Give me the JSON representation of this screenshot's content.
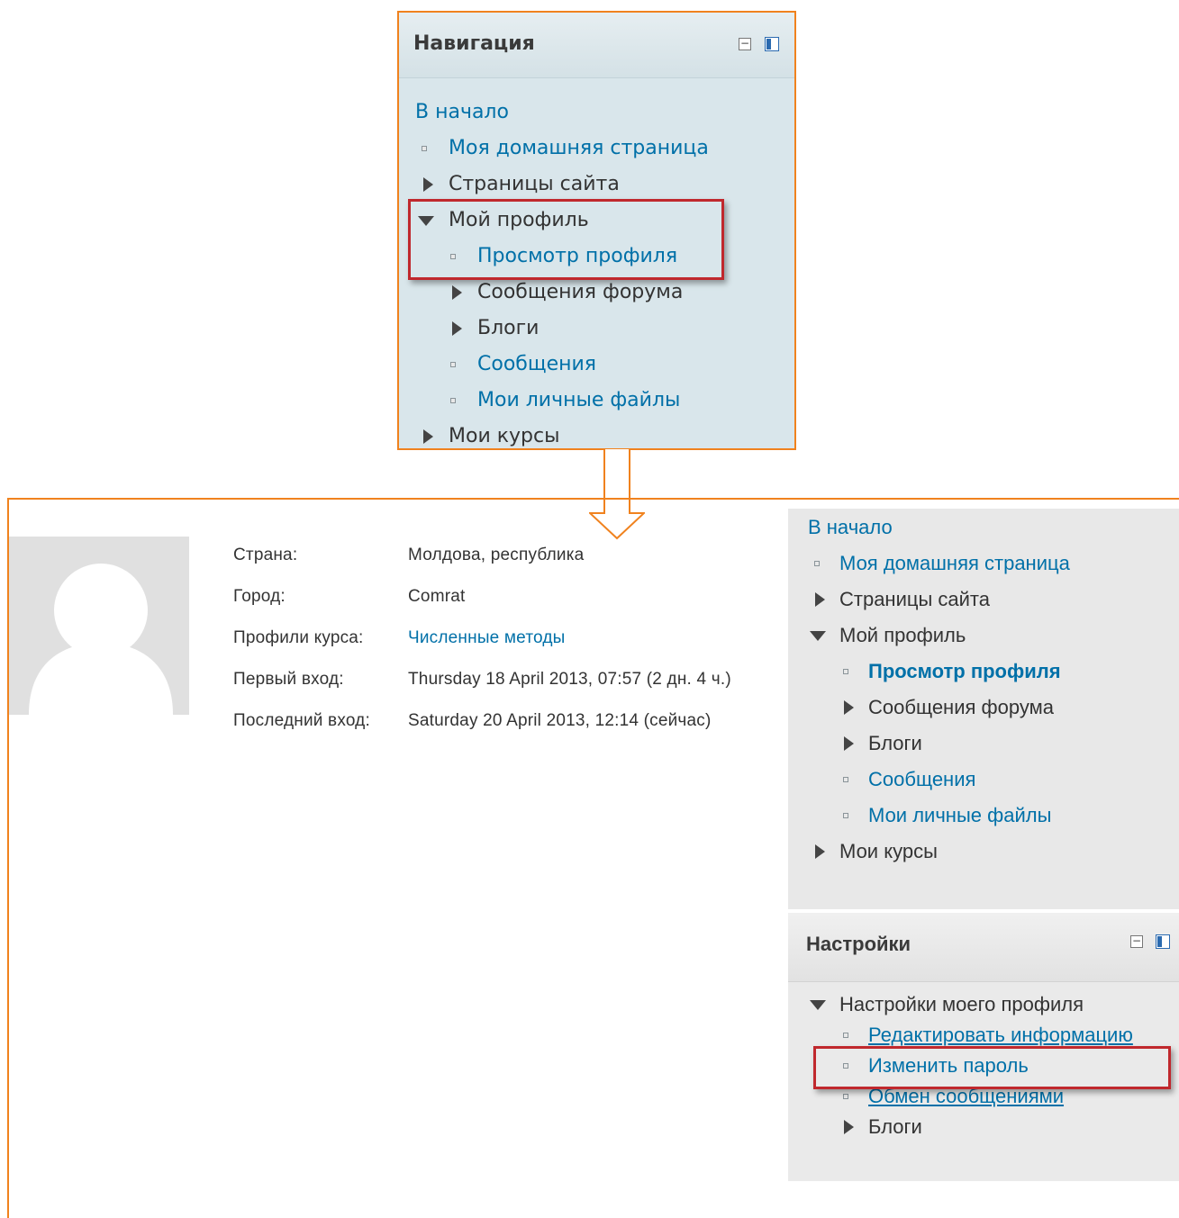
{
  "navigation_block": {
    "title": "Навигация",
    "items": [
      {
        "label": "В начало",
        "type": "link",
        "icon": "none"
      },
      {
        "label": "Моя домашняя страница",
        "type": "link",
        "icon": "bullet"
      },
      {
        "label": "Страницы сайта",
        "type": "branch",
        "icon": "triangle-right"
      },
      {
        "label": "Мой профиль",
        "type": "branch",
        "icon": "triangle-down"
      },
      {
        "label": "Просмотр профиля",
        "type": "link",
        "icon": "bullet"
      },
      {
        "label": "Сообщения форума",
        "type": "branch",
        "icon": "triangle-right"
      },
      {
        "label": "Блоги",
        "type": "branch",
        "icon": "triangle-right"
      },
      {
        "label": "Сообщения",
        "type": "link",
        "icon": "bullet"
      },
      {
        "label": "Мои личные файлы",
        "type": "link",
        "icon": "bullet"
      },
      {
        "label": "Мои курсы",
        "type": "branch",
        "icon": "triangle-right"
      }
    ]
  },
  "profile": {
    "fields": [
      {
        "label": "Страна:",
        "value": "Молдова, республика"
      },
      {
        "label": "Город:",
        "value": "Comrat"
      },
      {
        "label": "Профили курса:",
        "value": "Численные методы"
      },
      {
        "label": "Первый вход:",
        "value": "Thursday 18 April 2013, 07:57  (2 дн. 4 ч.)"
      },
      {
        "label": "Последний вход:",
        "value": "Saturday 20 April 2013, 12:14  (сейчас)"
      }
    ]
  },
  "sidebar_navigation": {
    "items": [
      {
        "label": "В начало"
      },
      {
        "label": "Моя домашняя страница"
      },
      {
        "label": "Страницы сайта"
      },
      {
        "label": "Мой профиль"
      },
      {
        "label": "Просмотр профиля"
      },
      {
        "label": "Сообщения форума"
      },
      {
        "label": "Блоги"
      },
      {
        "label": "Сообщения"
      },
      {
        "label": "Мои личные файлы"
      },
      {
        "label": "Мои курсы"
      }
    ]
  },
  "settings_block": {
    "title": "Настройки",
    "items": [
      {
        "label": "Настройки моего профиля"
      },
      {
        "label": "Редактировать информацию"
      },
      {
        "label": "Изменить пароль"
      },
      {
        "label": "Обмен сообщениями"
      },
      {
        "label": "Блоги"
      }
    ]
  },
  "colors": {
    "link": "#0070a8",
    "frame": "#f0821e",
    "highlight": "#c0282d",
    "nav_block_bg": "#d9e6eb"
  }
}
